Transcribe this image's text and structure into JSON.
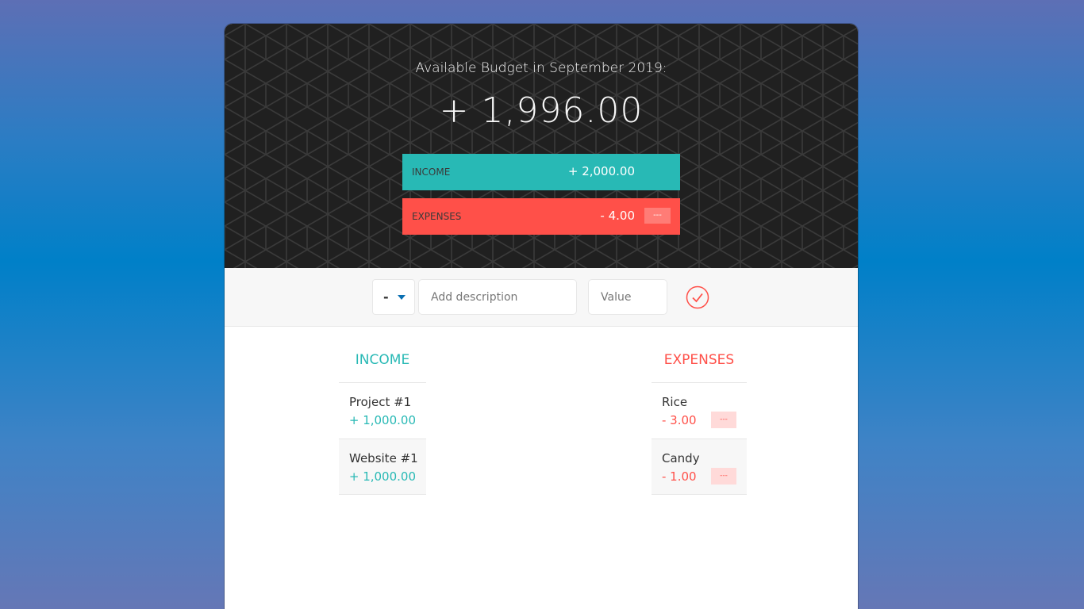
{
  "header": {
    "budget_title": "Available Budget in September 2019:",
    "budget_value": "+ 1,996.00",
    "income": {
      "label": "Income",
      "value": "+ 2,000.00"
    },
    "expenses": {
      "label": "Expenses",
      "value": "- 4.00",
      "percentage": "---"
    }
  },
  "add_form": {
    "type_value": "-",
    "description_placeholder": "Add description",
    "value_placeholder": "Value"
  },
  "income_list": {
    "title": "INCOME",
    "items": [
      {
        "description": "Project #1",
        "value": "+ 1,000.00"
      },
      {
        "description": "Website #1",
        "value": "+ 1,000.00"
      }
    ]
  },
  "expenses_list": {
    "title": "EXPENSES",
    "items": [
      {
        "description": "Rice",
        "value": "- 3.00",
        "percentage": "---"
      },
      {
        "description": "Candy",
        "value": "- 1.00",
        "percentage": "---"
      }
    ]
  },
  "colors": {
    "income": "#28b9b5",
    "expenses": "#ff5049",
    "header_bg": "#202020"
  }
}
